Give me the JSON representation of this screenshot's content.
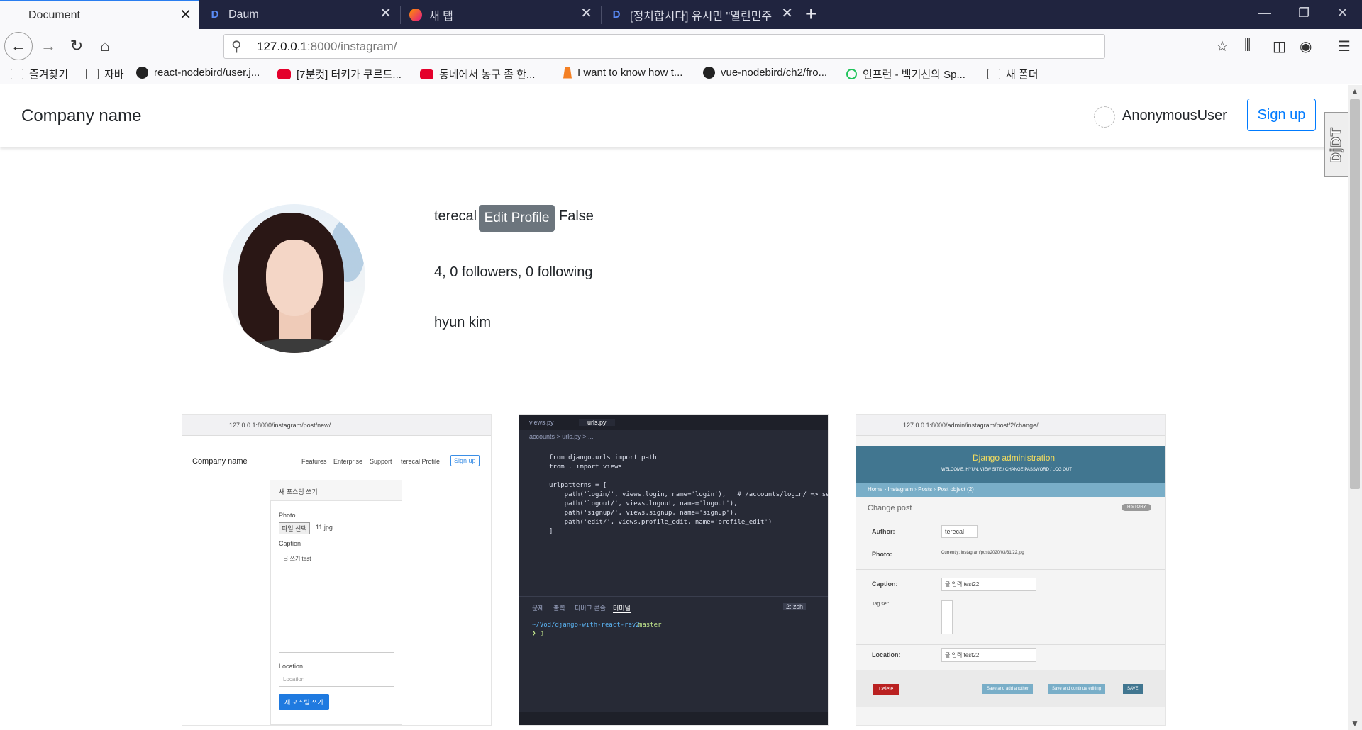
{
  "browser": {
    "tabs": [
      {
        "title": "Document",
        "active": true,
        "icon": "blank-page-icon"
      },
      {
        "title": "Daum",
        "active": false,
        "icon": "daum-d-icon"
      },
      {
        "title": "새 탭",
        "active": false,
        "icon": "firefox-icon"
      },
      {
        "title": "[정치합시다] 유시민 \"열린민주",
        "active": false,
        "icon": "daum-d-icon"
      }
    ],
    "url": {
      "host": "127.0.0.1",
      "rest": ":8000/instagram/"
    },
    "bookmarks": [
      {
        "label": "즐겨찾기",
        "icon": "folder-icon"
      },
      {
        "label": "자바",
        "icon": "folder-icon"
      },
      {
        "label": "react-nodebird/user.j...",
        "icon": "github-icon"
      },
      {
        "label": "[7분컷] 터키가 쿠르드...",
        "icon": "youtube-icon"
      },
      {
        "label": "동네에서 농구 좀 한...",
        "icon": "youtube-icon"
      },
      {
        "label": "I want to know how t...",
        "icon": "stackoverflow-icon"
      },
      {
        "label": "vue-nodebird/ch2/fro...",
        "icon": "github-icon"
      },
      {
        "label": "인프런 - 백기선의 Sp...",
        "icon": "inflearn-icon"
      },
      {
        "label": "새 폴더",
        "icon": "folder-icon"
      }
    ]
  },
  "site": {
    "brand": "Company name",
    "current_user": "AnonymousUser",
    "signup_label": "Sign up",
    "djdt_label": "DjDT"
  },
  "profile": {
    "username": "terecal",
    "edit_label": "Edit Profile",
    "flag": "False",
    "stats": "4, 0 followers, 0 following",
    "full_name": "hyun kim"
  },
  "thumbnails": {
    "t1": {
      "url": "127.0.0.1:8000/instagram/post/new/",
      "brand": "Company name",
      "nav": [
        "Features",
        "Enterprise",
        "Support",
        "terecal Profile"
      ],
      "signup": "Sign up",
      "card_title": "새 포스팅 쓰기",
      "photo_label": "Photo",
      "file_button": "파일 선택",
      "file_name": "11.jpg",
      "caption_label": "Caption",
      "caption_value": "글 쓰기 test",
      "location_label": "Location",
      "location_placeholder": "Location",
      "submit": "새 포스팅 쓰기"
    },
    "t2": {
      "tabs": [
        "views.py",
        "urls.py"
      ],
      "breadcrumb": "accounts > urls.py > ...",
      "code": [
        "from django.urls import path",
        "from . import views",
        "",
        "urlpatterns = [",
        "    path('login/', views.login, name='login'),   # /accounts/login/ => sett",
        "    path('logout/', views.logout, name='logout'),",
        "    path('signup/', views.signup, name='signup'),",
        "    path('edit/', views.profile_edit, name='profile_edit')",
        "]"
      ],
      "panel_tabs": [
        "문제",
        "출력",
        "디버그 콘솔",
        "터미널"
      ],
      "terminal_shell": "2: zsh",
      "terminal_path": "~/Vod/django-with-react-rev2",
      "terminal_branch": "master"
    },
    "t3": {
      "url": "127.0.0.1:8000/admin/instagram/post/2/change/",
      "header": "Django administration",
      "welcome": "WELCOME, HYUN. VIEW SITE / CHANGE PASSWORD / LOG OUT",
      "breadcrumb": "Home › Instagram › Posts › Post object (2)",
      "title": "Change post",
      "history": "HISTORY",
      "fields": [
        {
          "label": "Author:",
          "value": "terecal"
        },
        {
          "label": "Photo:",
          "value": "Currently: instagram/post/2020/03/31/22.jpg"
        },
        {
          "label": "Caption:",
          "value": "글 입력 test22"
        },
        {
          "label": "Tag set:",
          "value": ""
        },
        {
          "label": "Location:",
          "value": "글 입력 test22"
        }
      ],
      "buttons": [
        "Delete",
        "Save and add another",
        "Save and continue editing",
        "SAVE"
      ]
    }
  },
  "colors": {
    "accent": "#007bff",
    "secondary": "#6c757d",
    "tabbar": "#20243f",
    "django": "#417690"
  }
}
